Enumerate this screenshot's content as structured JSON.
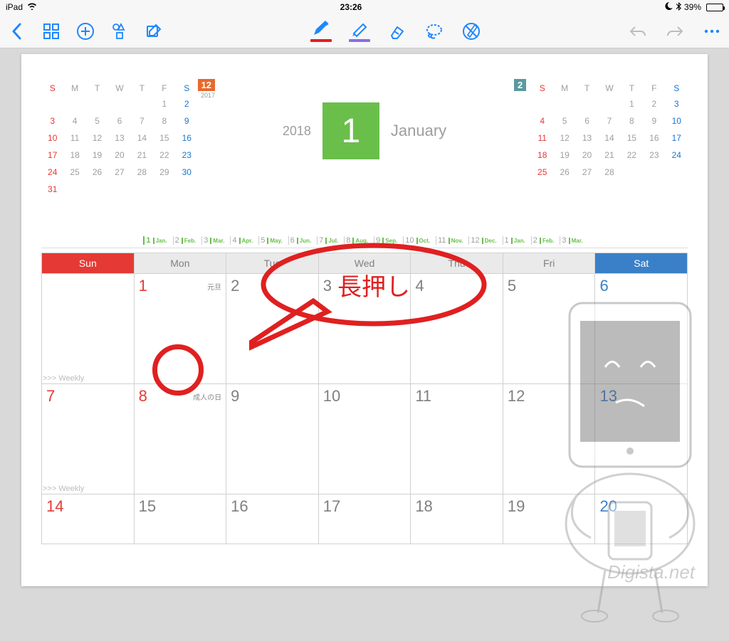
{
  "statusbar": {
    "device": "iPad",
    "time": "23:26",
    "battery_pct": "39%"
  },
  "toolbar": {
    "pen_underline_color": "#e02020",
    "highlighter_underline_color": "#8a6de8"
  },
  "header": {
    "year": "2018",
    "month_num": "1",
    "month_name": "January"
  },
  "mini_prev": {
    "badge": "12",
    "badge_year": "2017",
    "dow": [
      "S",
      "M",
      "T",
      "W",
      "T",
      "F",
      "S"
    ],
    "rows": [
      [
        "",
        "",
        "",
        "",
        "",
        "1",
        "2"
      ],
      [
        "3",
        "4",
        "5",
        "6",
        "7",
        "8",
        "9"
      ],
      [
        "10",
        "11",
        "12",
        "13",
        "14",
        "15",
        "16"
      ],
      [
        "17",
        "18",
        "19",
        "20",
        "21",
        "22",
        "23"
      ],
      [
        "24",
        "25",
        "26",
        "27",
        "28",
        "29",
        "30"
      ],
      [
        "31",
        "",
        "",
        "",
        "",
        "",
        ""
      ]
    ]
  },
  "mini_next": {
    "badge": "2",
    "dow": [
      "S",
      "M",
      "T",
      "W",
      "T",
      "F",
      "S"
    ],
    "rows": [
      [
        "",
        "",
        "",
        "",
        "1",
        "2",
        "3"
      ],
      [
        "4",
        "5",
        "6",
        "7",
        "8",
        "9",
        "10"
      ],
      [
        "11",
        "12",
        "13",
        "14",
        "15",
        "16",
        "17"
      ],
      [
        "18",
        "19",
        "20",
        "21",
        "22",
        "23",
        "24"
      ],
      [
        "25",
        "26",
        "27",
        "28",
        "",
        "",
        ""
      ]
    ]
  },
  "month_strip": [
    {
      "n": "1",
      "l": "Jan."
    },
    {
      "n": "2",
      "l": "Feb."
    },
    {
      "n": "3",
      "l": "Mar."
    },
    {
      "n": "4",
      "l": "Apr."
    },
    {
      "n": "5",
      "l": "May."
    },
    {
      "n": "6",
      "l": "Jun."
    },
    {
      "n": "7",
      "l": "Jul."
    },
    {
      "n": "8",
      "l": "Aug."
    },
    {
      "n": "9",
      "l": "Sep."
    },
    {
      "n": "10",
      "l": "Oct."
    },
    {
      "n": "11",
      "l": "Nov."
    },
    {
      "n": "12",
      "l": "Dec."
    },
    {
      "n": "1",
      "l": "Jan."
    },
    {
      "n": "2",
      "l": "Feb."
    },
    {
      "n": "3",
      "l": "Mar."
    }
  ],
  "calendar": {
    "dow": [
      "Sun",
      "Mon",
      "Tue",
      "Wed",
      "Thu",
      "Fri",
      "Sat"
    ],
    "weekly_label": ">>> Weekly",
    "rows": [
      [
        {
          "n": "",
          "cls": ""
        },
        {
          "n": "1",
          "cls": "red",
          "note": "元旦"
        },
        {
          "n": "2",
          "cls": ""
        },
        {
          "n": "3",
          "cls": ""
        },
        {
          "n": "4",
          "cls": ""
        },
        {
          "n": "5",
          "cls": ""
        },
        {
          "n": "6",
          "cls": "blue"
        }
      ],
      [
        {
          "n": "7",
          "cls": "red"
        },
        {
          "n": "8",
          "cls": "red",
          "note": "成人の日"
        },
        {
          "n": "9",
          "cls": ""
        },
        {
          "n": "10",
          "cls": ""
        },
        {
          "n": "11",
          "cls": ""
        },
        {
          "n": "12",
          "cls": ""
        },
        {
          "n": "13",
          "cls": "blue"
        }
      ],
      [
        {
          "n": "14",
          "cls": "red"
        },
        {
          "n": "15",
          "cls": ""
        },
        {
          "n": "16",
          "cls": ""
        },
        {
          "n": "17",
          "cls": ""
        },
        {
          "n": "18",
          "cls": ""
        },
        {
          "n": "19",
          "cls": ""
        },
        {
          "n": "20",
          "cls": "blue"
        }
      ]
    ]
  },
  "annotation": {
    "bubble_text": "長押し"
  },
  "watermark": "Digista.net"
}
